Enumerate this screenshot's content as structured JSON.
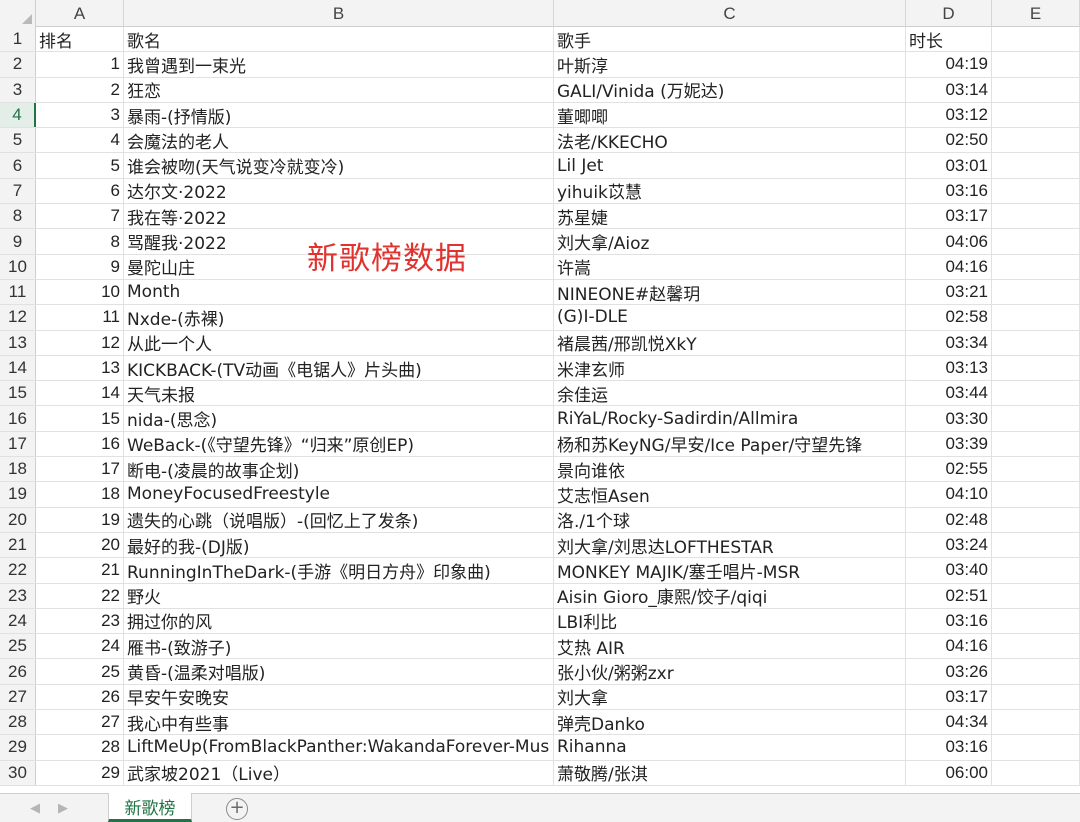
{
  "columns": [
    "A",
    "B",
    "C",
    "D",
    "E"
  ],
  "overlay_title": "新歌榜数据",
  "sheet_tab": "新歌榜",
  "header_row": {
    "row": "1",
    "a": "排名",
    "b": "歌名",
    "c": "歌手",
    "d": "时长"
  },
  "rows": [
    {
      "row": "2",
      "rank": "1",
      "song": "我曾遇到一束光",
      "artist": "叶斯淳",
      "duration": "04:19"
    },
    {
      "row": "3",
      "rank": "2",
      "song": "狂恋",
      "artist": "GALI/Vinida (万妮达)",
      "duration": "03:14"
    },
    {
      "row": "4",
      "rank": "3",
      "song": "暴雨-(抒情版)",
      "artist": "董唧唧",
      "duration": "03:12"
    },
    {
      "row": "5",
      "rank": "4",
      "song": "会魔法的老人",
      "artist": "法老/KKECHO",
      "duration": "02:50"
    },
    {
      "row": "6",
      "rank": "5",
      "song": "谁会被吻(天气说变冷就变冷)",
      "artist": "Lil Jet",
      "duration": "03:01"
    },
    {
      "row": "7",
      "rank": "6",
      "song": "达尔文·2022",
      "artist": "yihuik苡慧",
      "duration": "03:16"
    },
    {
      "row": "8",
      "rank": "7",
      "song": "我在等·2022",
      "artist": "苏星婕",
      "duration": "03:17"
    },
    {
      "row": "9",
      "rank": "8",
      "song": "骂醒我·2022",
      "artist": "刘大拿/Aioz",
      "duration": "04:06"
    },
    {
      "row": "10",
      "rank": "9",
      "song": "曼陀山庄",
      "artist": "许嵩",
      "duration": "04:16"
    },
    {
      "row": "11",
      "rank": "10",
      "song": "Month",
      "artist": "NINEONE#赵馨玥",
      "duration": "03:21"
    },
    {
      "row": "12",
      "rank": "11",
      "song": "Nxde-(赤裸)",
      "artist": "(G)I-DLE",
      "duration": "02:58"
    },
    {
      "row": "13",
      "rank": "12",
      "song": "从此一个人",
      "artist": "褚晨茜/邢凯悦XkY",
      "duration": "03:34"
    },
    {
      "row": "14",
      "rank": "13",
      "song": "KICKBACK-(TV动画《电锯人》片头曲)",
      "artist": "米津玄师",
      "duration": "03:13"
    },
    {
      "row": "15",
      "rank": "14",
      "song": "天气未报",
      "artist": "余佳运",
      "duration": "03:44"
    },
    {
      "row": "16",
      "rank": "15",
      "song": "nida-(思念)",
      "artist": "RiYaL/Rocky-Sadirdin/Allmira",
      "duration": "03:30"
    },
    {
      "row": "17",
      "rank": "16",
      "song": "WeBack-(《守望先锋》“归来”原创EP)",
      "artist": "杨和苏KeyNG/早安/Ice Paper/守望先锋",
      "duration": "03:39"
    },
    {
      "row": "18",
      "rank": "17",
      "song": "断电-(凌晨的故事企划)",
      "artist": "景向谁依",
      "duration": "02:55"
    },
    {
      "row": "19",
      "rank": "18",
      "song": "MoneyFocusedFreestyle",
      "artist": "艾志恒Asen",
      "duration": "04:10"
    },
    {
      "row": "20",
      "rank": "19",
      "song": "遗失的心跳（说唱版）-(回忆上了发条)",
      "artist": "洛./1个球",
      "duration": "02:48"
    },
    {
      "row": "21",
      "rank": "20",
      "song": "最好的我-(DJ版)",
      "artist": "刘大拿/刘思达LOFTHESTAR",
      "duration": "03:24"
    },
    {
      "row": "22",
      "rank": "21",
      "song": "RunningInTheDark-(手游《明日方舟》印象曲)",
      "artist": "MONKEY MAJIK/塞壬唱片-MSR",
      "duration": "03:40"
    },
    {
      "row": "23",
      "rank": "22",
      "song": "野火",
      "artist": "Aisin Gioro_康熙/饺子/qiqi",
      "duration": "02:51"
    },
    {
      "row": "24",
      "rank": "23",
      "song": "拥过你的风",
      "artist": "LBI利比",
      "duration": "03:16"
    },
    {
      "row": "25",
      "rank": "24",
      "song": "雁书-(致游子)",
      "artist": "艾热 AIR",
      "duration": "04:16"
    },
    {
      "row": "26",
      "rank": "25",
      "song": "黄昏-(温柔对唱版)",
      "artist": "张小伙/粥粥zxr",
      "duration": "03:26"
    },
    {
      "row": "27",
      "rank": "26",
      "song": "早安午安晚安",
      "artist": "刘大拿",
      "duration": "03:17"
    },
    {
      "row": "28",
      "rank": "27",
      "song": "我心中有些事",
      "artist": "弹壳Danko",
      "duration": "04:34"
    },
    {
      "row": "29",
      "rank": "28",
      "song": "LiftMeUp(FromBlackPanther:WakandaForever-Mus",
      "artist": "Rihanna",
      "duration": "03:16"
    },
    {
      "row": "30",
      "rank": "29",
      "song": "武家坡2021（Live）",
      "artist": "萧敬腾/张淇",
      "duration": "06:00"
    }
  ]
}
